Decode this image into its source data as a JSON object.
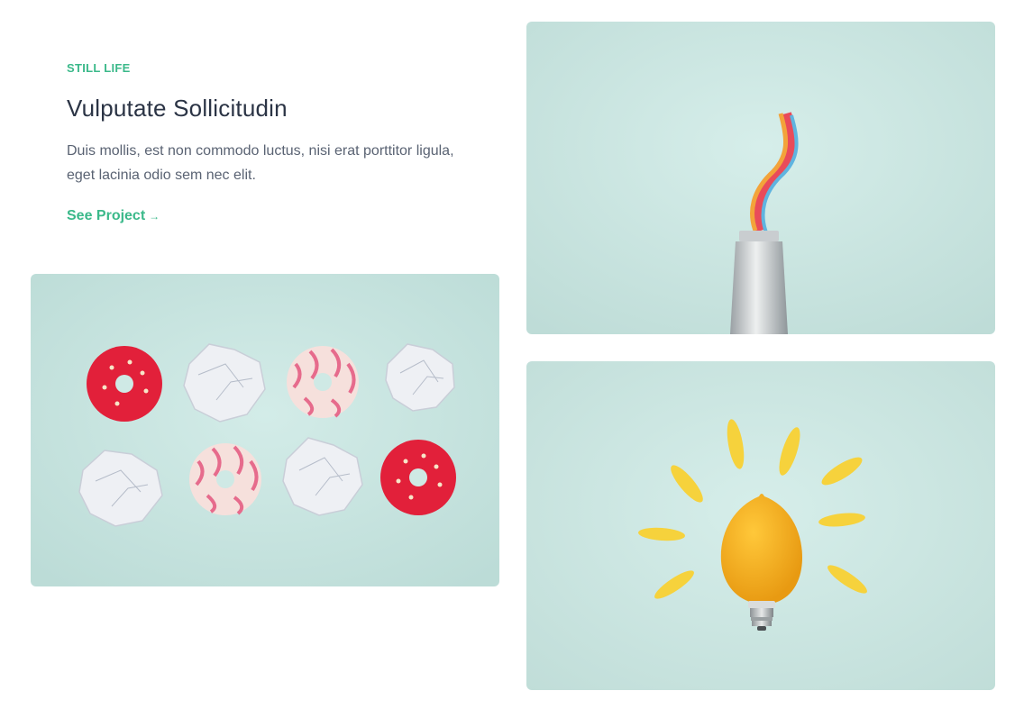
{
  "project": {
    "category": "STILL LIFE",
    "title": "Vulputate Sollicitudin",
    "description": "Duis mollis, est non commodo luctus, nisi erat porttitor ligula, eget lacinia odio sem nec elit.",
    "link_label": "See Project",
    "link_arrow": "→"
  },
  "colors": {
    "accent": "#3bb98a",
    "heading": "#2b3445",
    "body_text": "#5a6373",
    "photo_background": "#cfe9e5"
  },
  "gallery": [
    {
      "subject": "donuts-and-crumpled-paper-photo"
    },
    {
      "subject": "candy-toothpaste-tube-photo"
    },
    {
      "subject": "lemon-lightbulb-photo"
    }
  ]
}
